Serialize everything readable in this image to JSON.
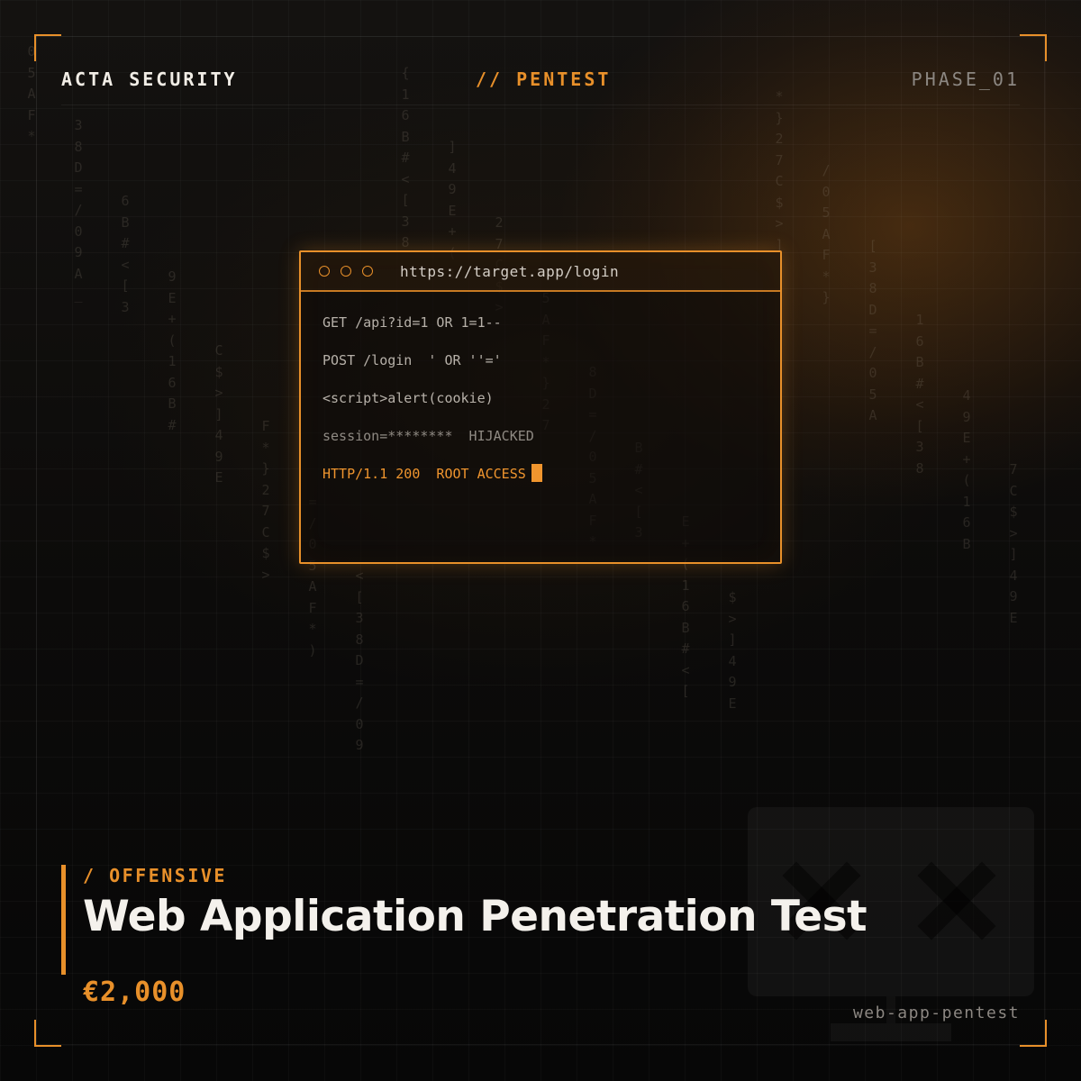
{
  "header": {
    "brand": "ACTA SECURITY",
    "category": "// PENTEST",
    "phase": "PHASE_01"
  },
  "terminal": {
    "url": "https://target.app/login",
    "lines": [
      "GET /api?id=1 OR 1=1--",
      "POST /login  ' OR ''='",
      "<script>alert(cookie)",
      "session=********  HIJACKED",
      "HTTP/1.1 200  ROOT ACCESS"
    ]
  },
  "product": {
    "tag": "/ OFFENSIVE",
    "title": "Web Application Penetration Test",
    "price": "€2,000",
    "slug": "web-app-pentest"
  },
  "colors": {
    "accent": "#e8902a",
    "background": "#0a0a0a",
    "text": "#f4f1ec"
  },
  "icons": [
    "browser-window-icon",
    "monitor-x-icon"
  ]
}
